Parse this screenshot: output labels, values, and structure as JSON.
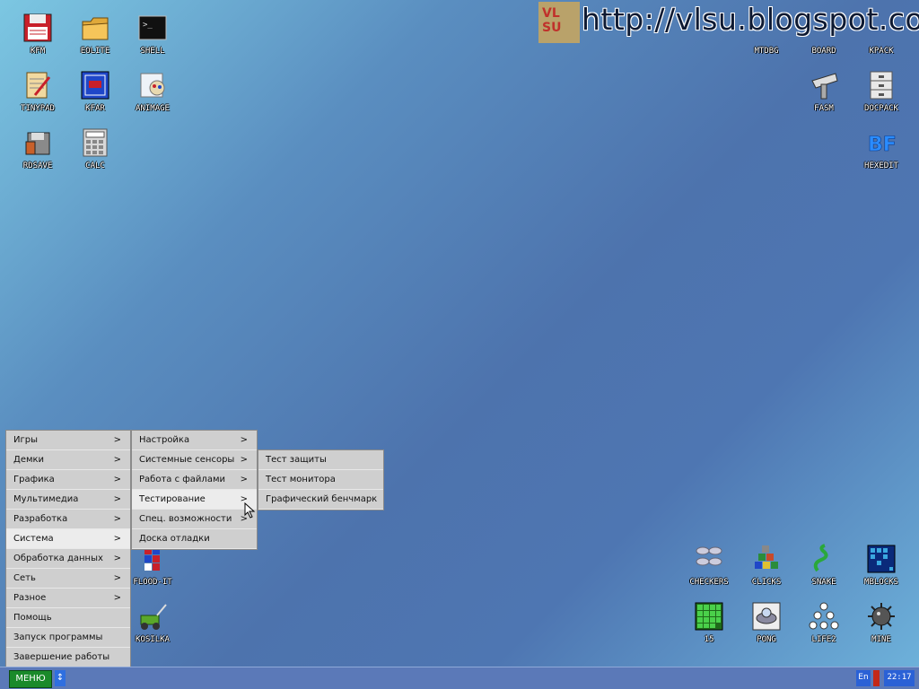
{
  "watermark": {
    "logo_text": "VL SU",
    "url": "http://vlsu.blogspot.com"
  },
  "desktop_icons": {
    "kfm": "KFM",
    "eolite": "EOLITE",
    "shell": "SHELL",
    "tinypad": "TINYPAD",
    "kfar": "KFAR",
    "animage": "ANIMAGE",
    "rdsave": "RDSAVE",
    "calc": "CALC",
    "mtdbg": "MTDBG",
    "board": "BOARD",
    "kpack": "KPACK",
    "fasm": "FASM",
    "docpack": "DOCPACK",
    "hexedit": "HEXEDIT",
    "floodit": "FLOOD-IT",
    "kosilka": "KOSILKA",
    "checkers": "CHECKERS",
    "clicks": "CLICKS",
    "snake": "SNAKE",
    "mblocks": "MBLOCKS",
    "fifteen": "15",
    "pong": "PONG",
    "life2": "LIFE2",
    "mine": "MINE"
  },
  "main_menu": [
    {
      "label": "Игры",
      "arrow": ">"
    },
    {
      "label": "Демки",
      "arrow": ">"
    },
    {
      "label": "Графика",
      "arrow": ">"
    },
    {
      "label": "Мультимедиа",
      "arrow": ">"
    },
    {
      "label": "Разработка",
      "arrow": ">"
    },
    {
      "label": "Система",
      "arrow": ">"
    },
    {
      "label": "Обработка данных",
      "arrow": ">"
    },
    {
      "label": "Сеть",
      "arrow": ">"
    },
    {
      "label": "Разное",
      "arrow": ">"
    },
    {
      "label": "Помощь",
      "arrow": ""
    },
    {
      "label": "Запуск программы",
      "arrow": ""
    },
    {
      "label": "Завершение работы",
      "arrow": ""
    }
  ],
  "system_menu": [
    {
      "label": "Настройка",
      "arrow": ">"
    },
    {
      "label": "Системные сенсоры",
      "arrow": ">"
    },
    {
      "label": "Работа с файлами",
      "arrow": ">"
    },
    {
      "label": "Тестирование",
      "arrow": ">"
    },
    {
      "label": "Спец. возможности",
      "arrow": ">"
    },
    {
      "label": "Доска отладки",
      "arrow": ""
    }
  ],
  "testing_menu": [
    {
      "label": "Тест защиты"
    },
    {
      "label": "Тест монитора"
    },
    {
      "label": "Графический бенчмарк"
    }
  ],
  "taskbar": {
    "menu_label": "МЕНЮ",
    "scroll": "↕",
    "lang": "En",
    "clock": "22:17"
  },
  "colors": {
    "accent_green": "#1a8a2a",
    "tray_blue": "#2a61d6",
    "indicator_red": "#c42818"
  }
}
